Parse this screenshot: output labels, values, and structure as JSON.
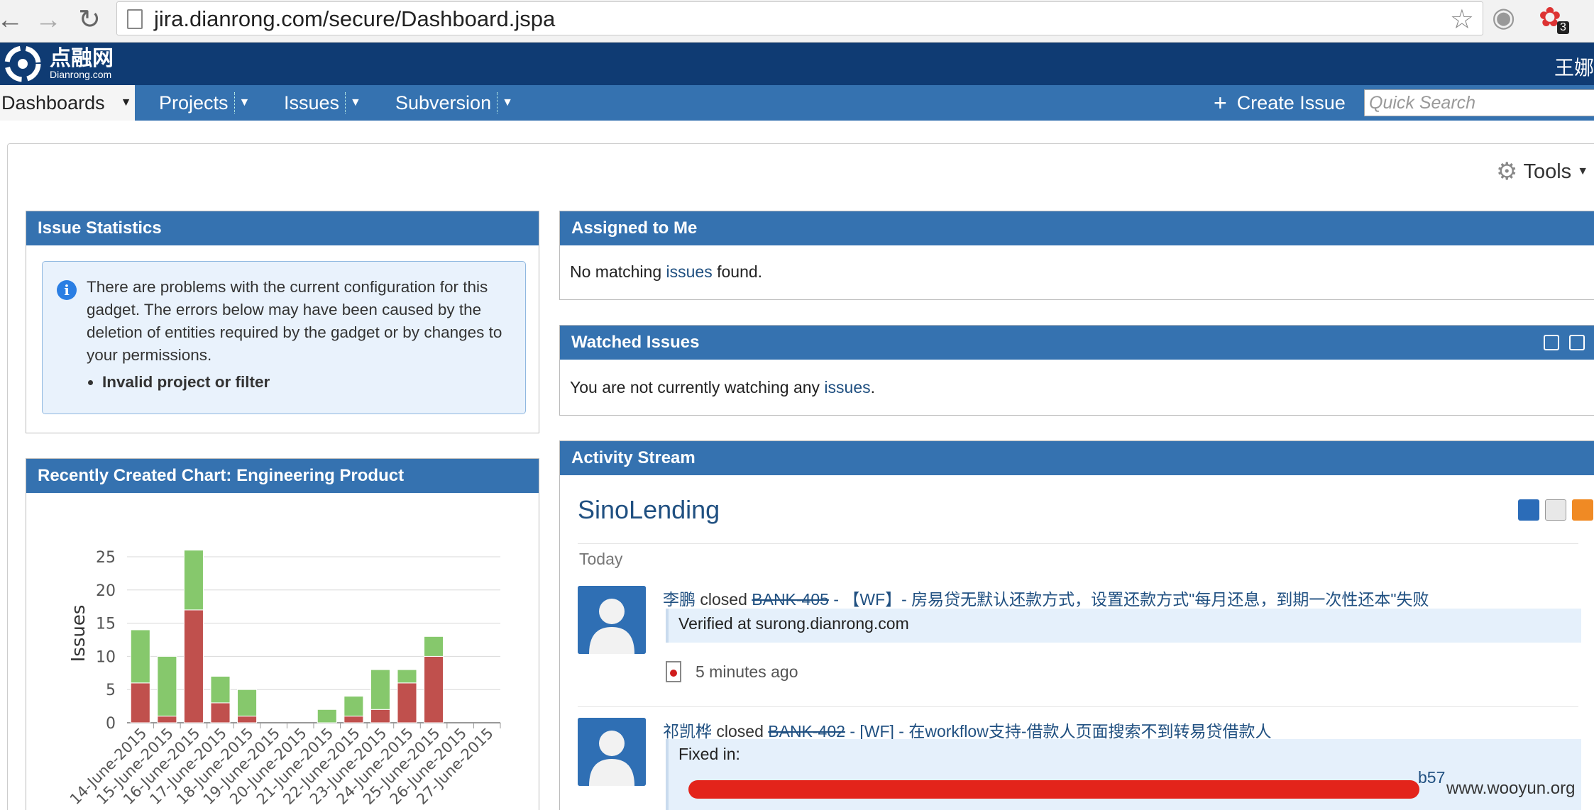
{
  "browser": {
    "url": "jira.dianrong.com/secure/Dashboard.jspa",
    "badge": "3"
  },
  "header": {
    "logo_cn": "点融网",
    "logo_en": "Dianrong.com",
    "user": "王娜"
  },
  "nav": {
    "items": [
      "Dashboards",
      "Projects",
      "Issues",
      "Subversion"
    ],
    "create_issue": "Create Issue",
    "search_placeholder": "Quick Search"
  },
  "toolbar": {
    "tools": "Tools"
  },
  "issue_statistics": {
    "title": "Issue Statistics",
    "message": "There are problems with the current configuration for this gadget. The errors below may have been caused by the deletion of entities required by the gadget or by changes to your permissions.",
    "error": "Invalid project or filter"
  },
  "assigned": {
    "title": "Assigned to Me",
    "before": "No matching ",
    "link": "issues",
    "after": " found."
  },
  "watched": {
    "title": "Watched Issues",
    "before": "You are not currently watching any ",
    "link": "issues",
    "after": "."
  },
  "recent_chart": {
    "title": "Recently Created Chart: Engineering Product"
  },
  "chart_data": {
    "type": "bar",
    "stacked": true,
    "ylabel": "Issues",
    "ylim": [
      0,
      25
    ],
    "yticks": [
      "0",
      "5",
      "10",
      "15",
      "20",
      "25"
    ],
    "categories": [
      "14-June-2015",
      "15-June-2015",
      "16-June-2015",
      "17-June-2015",
      "18-June-2015",
      "19-June-2015",
      "20-June-2015",
      "21-June-2015",
      "22-June-2015",
      "23-June-2015",
      "24-June-2015",
      "25-June-2015",
      "26-June-2015",
      "27-June-2015"
    ],
    "series": [
      {
        "color": "#c0504d",
        "values": [
          6,
          1,
          17,
          3,
          1,
          0,
          0,
          0,
          1,
          2,
          6,
          10,
          0,
          0
        ]
      },
      {
        "color": "#86c86c",
        "values": [
          8,
          9,
          9,
          4,
          4,
          0,
          0,
          2,
          3,
          6,
          2,
          3,
          0,
          0
        ]
      }
    ]
  },
  "activity": {
    "title": "Activity Stream",
    "project": "SinoLending",
    "today": "Today",
    "entries": [
      {
        "user": "李鹏",
        "action": " closed ",
        "key": "BANK-405",
        "summary": " - 【WF】- 房易贷无默认还款方式，设置还款方式\"每月还息，到期一次性还本\"失败",
        "comment": "Verified at surong.dianrong.com",
        "time": "5 minutes ago"
      },
      {
        "user": "祁凯桦",
        "action": " closed ",
        "key": "BANK-402",
        "summary": " - [WF] - 在workflow支持-借款人页面搜索不到转易贷借款人",
        "comment": "Fixed in:",
        "commit_tail": "b57"
      }
    ]
  },
  "watermark": "www.wooyun.org",
  "colors": {
    "header": "#0f3b73",
    "nav": "#3572b0",
    "link": "#205081"
  }
}
